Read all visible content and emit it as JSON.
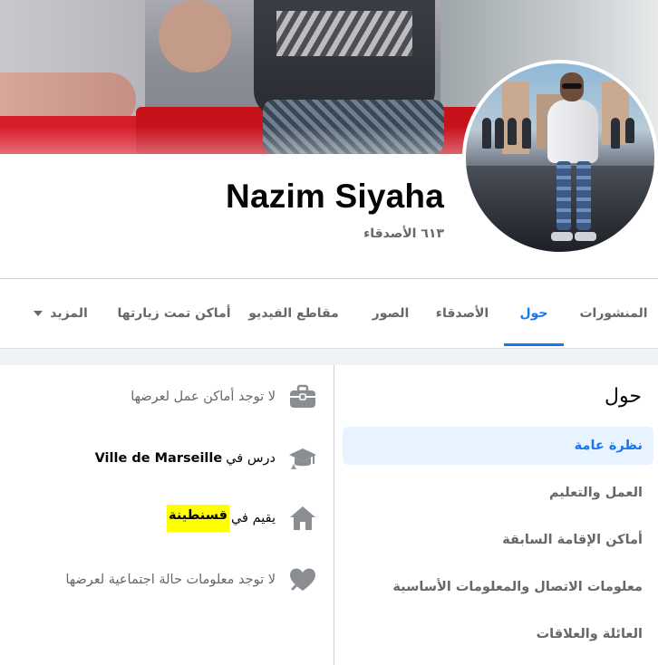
{
  "profile": {
    "name": "Nazim Siyaha",
    "friends_count": "٦١٣ الأصدقاء"
  },
  "tabs": [
    {
      "label": "المنشورات",
      "active": false
    },
    {
      "label": "حول",
      "active": true
    },
    {
      "label": "الأصدقاء",
      "active": false
    },
    {
      "label": "الصور",
      "active": false
    },
    {
      "label": "مقاطع الفيديو",
      "active": false
    },
    {
      "label": "أماكن تمت زيارتها",
      "active": false
    },
    {
      "label": "المزيد",
      "active": false,
      "icon": "caret-down-icon"
    }
  ],
  "about": {
    "title": "حول",
    "sections": [
      {
        "label": "نظرة عامة",
        "active": true
      },
      {
        "label": "العمل والتعليم",
        "active": false
      },
      {
        "label": "أماكن الإقامة السابقة",
        "active": false
      },
      {
        "label": "معلومات الاتصال والمعلومات الأساسية",
        "active": false
      },
      {
        "label": "العائلة والعلاقات",
        "active": false
      }
    ]
  },
  "details": {
    "work": {
      "icon": "briefcase-icon",
      "text": "لا توجد أماكن عمل لعرضها"
    },
    "education": {
      "icon": "graduation-cap-icon",
      "prefix": "درس في",
      "value": "Ville de Marseille"
    },
    "residence": {
      "icon": "home-icon",
      "prefix": "يقيم في",
      "value": "قسنطينة"
    },
    "relationship": {
      "icon": "heart-icon",
      "text": "لا توجد معلومات حالة اجتماعية لعرضها"
    }
  },
  "colors": {
    "accent": "#1877f2",
    "secondary_text": "#65676b",
    "highlight": "#ffff00",
    "active_bg": "#e7f3ff",
    "icon_gray": "#8a8d91"
  }
}
